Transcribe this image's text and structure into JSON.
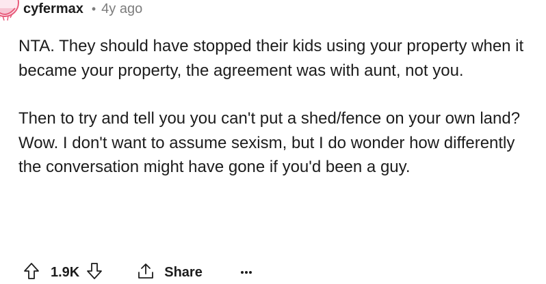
{
  "comment": {
    "author": "cyfermax",
    "separator": "•",
    "age": "4y ago",
    "paragraphs": [
      "NTA. They should have stopped their kids using your property when it became your property, the agreement was with aunt, not you.",
      "Then to try and tell you you can't put a shed/fence on your own land? Wow. I don't want to assume sexism, but I do wonder how differently the conversation might have gone if you'd been a guy."
    ],
    "score": "1.9K",
    "share_label": "Share"
  },
  "icons": {
    "avatar": "snoo-avatar",
    "upvote": "upvote-arrow-icon",
    "downvote": "downvote-arrow-icon",
    "share": "share-icon",
    "more": "more-options-icon"
  },
  "colors": {
    "text": "#1c1c1c",
    "muted": "#7c7c7c",
    "avatar_accent": "#e85a7a"
  }
}
